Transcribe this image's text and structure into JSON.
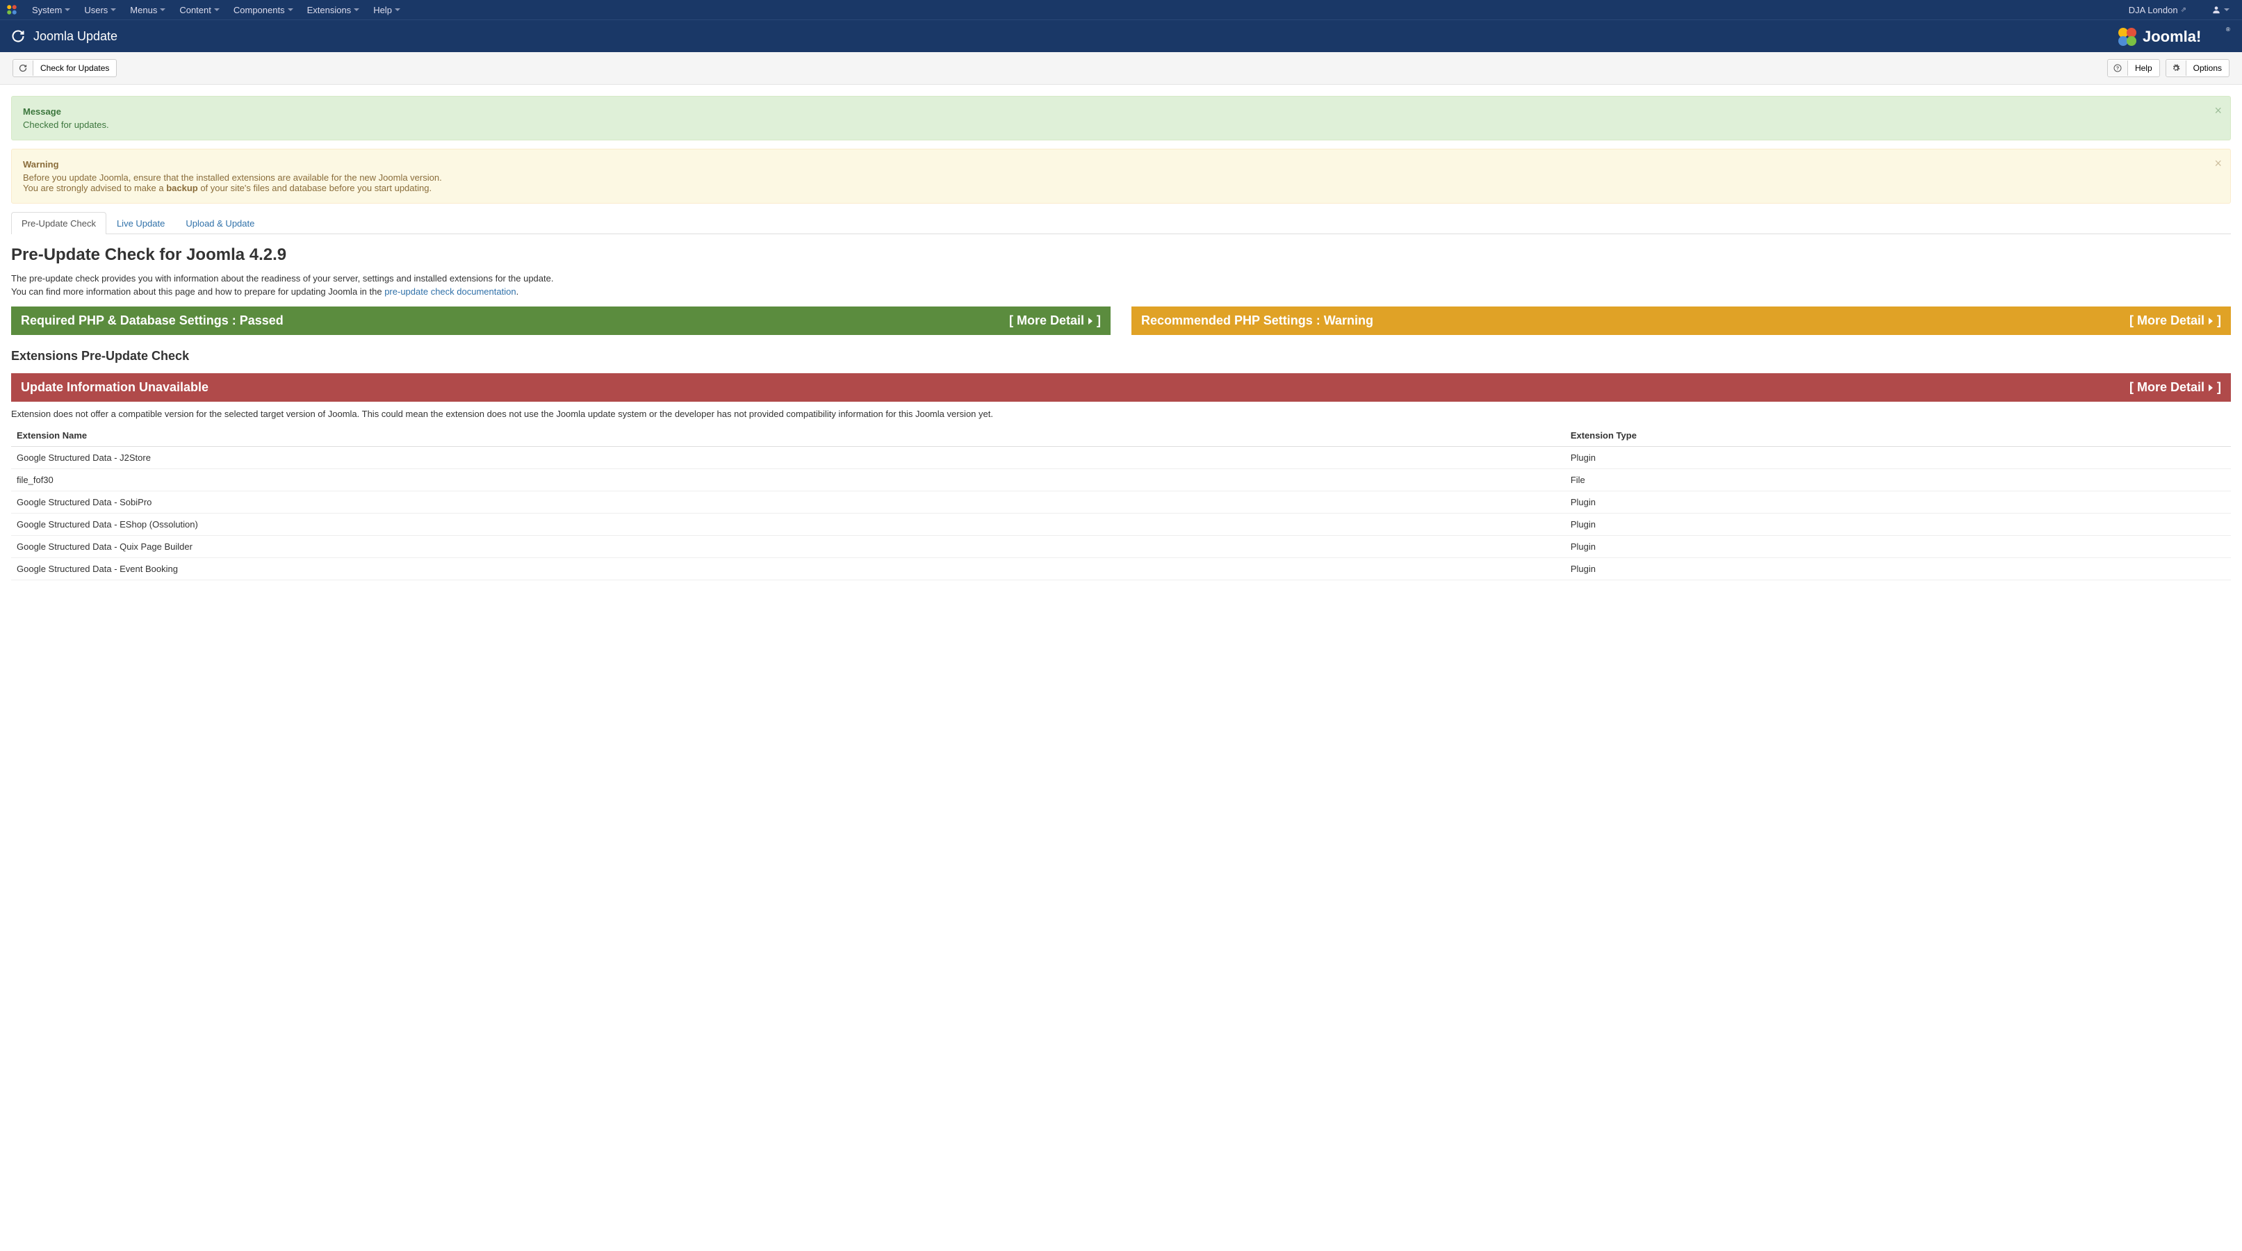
{
  "topbar": {
    "menus": [
      "System",
      "Users",
      "Menus",
      "Content",
      "Components",
      "Extensions",
      "Help"
    ],
    "site_name": "DJA London"
  },
  "header": {
    "title": "Joomla Update",
    "brand": "Joomla!"
  },
  "toolbar": {
    "check_updates": "Check for Updates",
    "help": "Help",
    "options": "Options"
  },
  "alerts": {
    "message_heading": "Message",
    "message_body": "Checked for updates.",
    "warning_heading": "Warning",
    "warning_line1": "Before you update Joomla, ensure that the installed extensions are available for the new Joomla version.",
    "warning_line2a": "You are strongly advised to make a ",
    "warning_bold": "backup",
    "warning_line2b": " of your site's files and database before you start updating."
  },
  "tabs": {
    "preupdate": "Pre-Update Check",
    "live": "Live Update",
    "upload": "Upload & Update"
  },
  "page": {
    "heading": "Pre-Update Check for Joomla 4.2.9",
    "intro1": "The pre-update check provides you with information about the readiness of your server, settings and installed extensions for the update.",
    "intro2a": "You can find more information about this page and how to prepare for updating Joomla in the ",
    "intro_link": "pre-update check documentation",
    "intro2b": "."
  },
  "panels": {
    "required": "Required PHP & Database Settings : Passed",
    "recommended": "Recommended PHP Settings : Warning",
    "more_detail_pre": "[  More Detail",
    "more_detail_post": "]"
  },
  "extensions": {
    "heading": "Extensions Pre-Update Check",
    "unavailable": "Update Information Unavailable",
    "desc": "Extension does not offer a compatible version for the selected target version of Joomla. This could mean the extension does not use the Joomla update system or the developer has not provided compatibility information for this Joomla version yet.",
    "col_name": "Extension Name",
    "col_type": "Extension Type",
    "rows": [
      {
        "name": "Google Structured Data - J2Store",
        "type": "Plugin"
      },
      {
        "name": "file_fof30",
        "type": "File"
      },
      {
        "name": "Google Structured Data - SobiPro",
        "type": "Plugin"
      },
      {
        "name": "Google Structured Data - EShop (Ossolution)",
        "type": "Plugin"
      },
      {
        "name": "Google Structured Data - Quix Page Builder",
        "type": "Plugin"
      },
      {
        "name": "Google Structured Data - Event Booking",
        "type": "Plugin"
      }
    ]
  }
}
